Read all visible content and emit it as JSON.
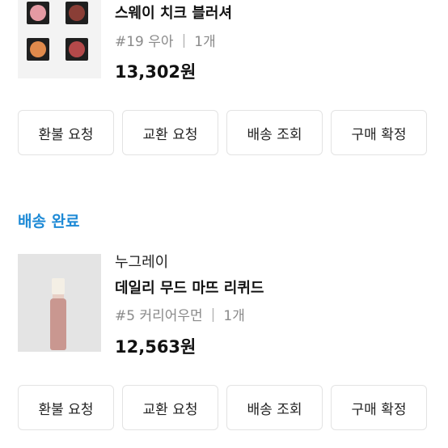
{
  "orders": [
    {
      "product_name": "스웨이 치크 블러셔",
      "option": "#19 우아",
      "option_sep": "|",
      "quantity": "1개",
      "price": "13,302원",
      "swatch_colors": [
        "#e49aa3",
        "#8a3e36",
        "#e08a4c",
        "#b3494a"
      ],
      "buttons": [
        "환불 요청",
        "교환 요청",
        "배송 조회",
        "구매 확정"
      ]
    },
    {
      "status": "배송 완료",
      "brand": "누그레이",
      "product_name": "데일리 무드 마뜨 리퀴드",
      "option": "#5 커리어우먼",
      "option_sep": "|",
      "quantity": "1개",
      "price": "12,563원",
      "buttons": [
        "환불 요청",
        "교환 요청",
        "배송 조회",
        "구매 확정"
      ]
    }
  ],
  "colors": {
    "status_blue": "#1e8ad6",
    "border": "#e3e3e3",
    "muted_text": "#8a8a8a"
  }
}
